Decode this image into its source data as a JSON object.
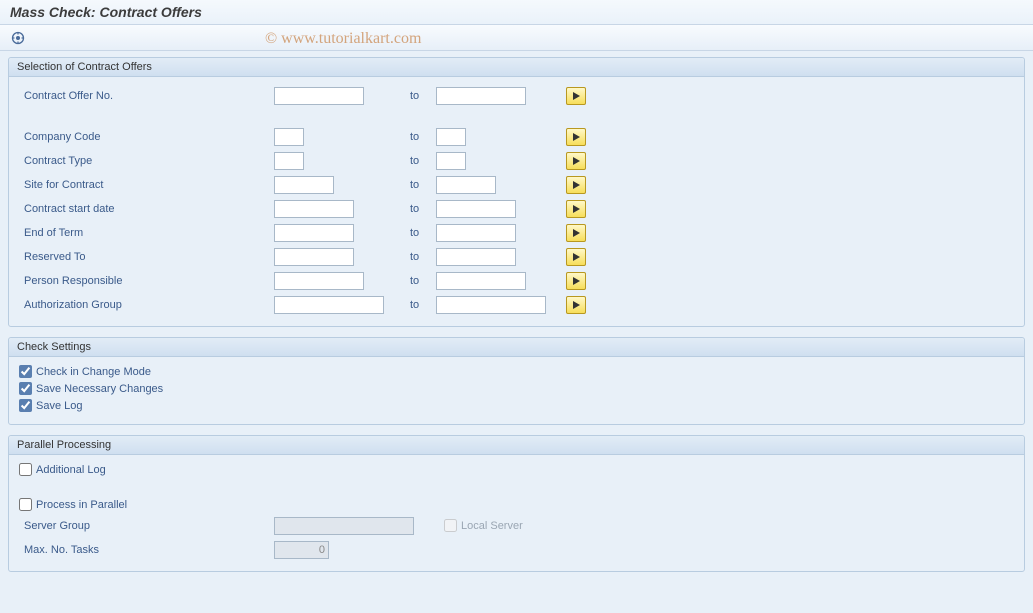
{
  "title": "Mass Check: Contract Offers",
  "watermark": "© www.tutorialkart.com",
  "groups": {
    "selection": {
      "title": "Selection of Contract Offers",
      "fields": {
        "contract_offer_no": {
          "label": "Contract Offer No.",
          "from": "",
          "to_label": "to",
          "to": ""
        },
        "company_code": {
          "label": "Company Code",
          "from": "",
          "to_label": "to",
          "to": ""
        },
        "contract_type": {
          "label": "Contract Type",
          "from": "",
          "to_label": "to",
          "to": ""
        },
        "site": {
          "label": "Site for Contract",
          "from": "",
          "to_label": "to",
          "to": ""
        },
        "start_date": {
          "label": "Contract start date",
          "from": "",
          "to_label": "to",
          "to": ""
        },
        "end_of_term": {
          "label": "End of Term",
          "from": "",
          "to_label": "to",
          "to": ""
        },
        "reserved_to": {
          "label": "Reserved To",
          "from": "",
          "to_label": "to",
          "to": ""
        },
        "person_resp": {
          "label": "Person Responsible",
          "from": "",
          "to_label": "to",
          "to": ""
        },
        "auth_group": {
          "label": "Authorization Group",
          "from": "",
          "to_label": "to",
          "to": ""
        }
      }
    },
    "check_settings": {
      "title": "Check Settings",
      "change_mode": {
        "label": "Check in Change Mode",
        "checked": true
      },
      "save_changes": {
        "label": "Save Necessary Changes",
        "checked": true
      },
      "save_log": {
        "label": "Save Log",
        "checked": true
      }
    },
    "parallel": {
      "title": "Parallel Processing",
      "additional_log": {
        "label": "Additional Log",
        "checked": false
      },
      "process_parallel": {
        "label": "Process in Parallel",
        "checked": false
      },
      "server_group": {
        "label": "Server Group",
        "value": ""
      },
      "local_server": {
        "label": "Local Server",
        "checked": false
      },
      "max_tasks": {
        "label": "Max. No. Tasks",
        "value": "0"
      }
    }
  }
}
